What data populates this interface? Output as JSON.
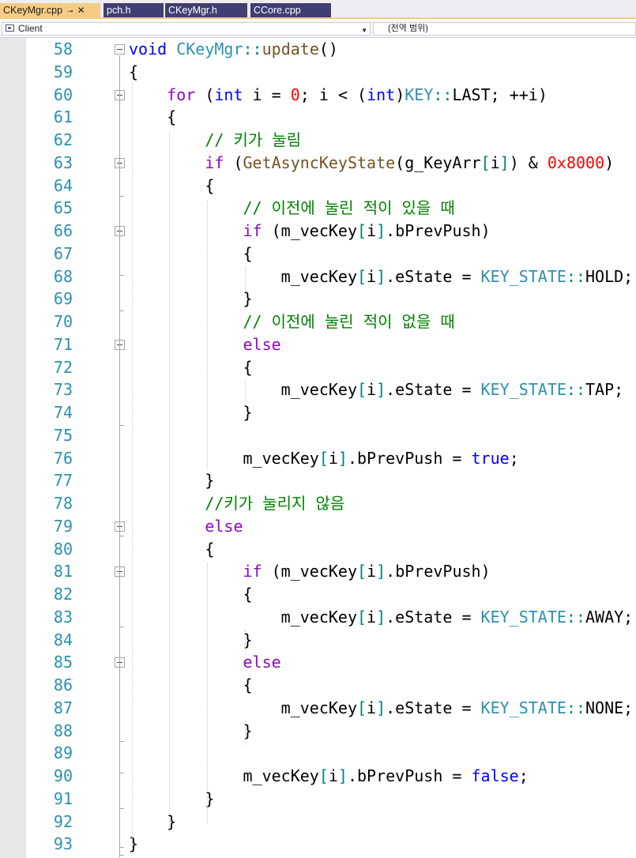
{
  "tabs": [
    {
      "label": "CKeyMgr.cpp",
      "active": true,
      "pin_icon": "pin-icon",
      "close_icon": "close-icon"
    },
    {
      "label": "pch.h",
      "active": false
    },
    {
      "label": "CKeyMgr.h",
      "active": false
    },
    {
      "label": "CCore.cpp",
      "active": false
    }
  ],
  "navbar": {
    "project": "Client",
    "scope": "(전역 범위)"
  },
  "colors": {
    "tab_active": "#f5cc84",
    "tab_inactive": "#3f3f74",
    "line_number": "#2b91af",
    "keyword": "#0000ff",
    "control_keyword": "#8f08c4",
    "function": "#74531f",
    "type": "#2b91af",
    "number": "#ff0000",
    "comment": "#008000"
  },
  "lines": [
    {
      "n": "58",
      "fold": true,
      "tokens": [
        [
          "kw",
          "void"
        ],
        [
          "",
          " "
        ],
        [
          "cls",
          "CKeyMgr"
        ],
        [
          "op",
          "::"
        ],
        [
          "fn",
          "update"
        ],
        [
          "",
          "()"
        ]
      ]
    },
    {
      "n": "59",
      "tokens": [
        [
          "",
          "{"
        ]
      ]
    },
    {
      "n": "60",
      "fold": true,
      "tokens": [
        [
          "",
          "    "
        ],
        [
          "kw2",
          "for"
        ],
        [
          "",
          ""
        ],
        [
          "",
          ""
        ],
        [
          "",
          " ("
        ],
        [
          "kw",
          "int"
        ],
        [
          "",
          " i = "
        ],
        [
          "num",
          "0"
        ],
        [
          "",
          "; i < ("
        ],
        [
          "kw",
          "int"
        ],
        [
          "",
          ")"
        ],
        [
          "cls",
          "KEY"
        ],
        [
          "op",
          "::"
        ],
        [
          "",
          "LAST; ++i)"
        ]
      ]
    },
    {
      "n": "61",
      "tokens": [
        [
          "",
          "    {"
        ]
      ]
    },
    {
      "n": "62",
      "tokens": [
        [
          "",
          "        "
        ],
        [
          "cm",
          "// 키가 눌림"
        ]
      ]
    },
    {
      "n": "63",
      "fold": true,
      "tokens": [
        [
          "",
          "        "
        ],
        [
          "kw2",
          "if"
        ],
        [
          "",
          " ("
        ],
        [
          "fn",
          "GetAsyncKeyState"
        ],
        [
          "",
          "(g_KeyArr"
        ],
        [
          "op",
          "["
        ],
        [
          "",
          "i"
        ],
        [
          "op",
          "]"
        ],
        [
          "",
          ") & "
        ],
        [
          "num",
          "0x8000"
        ],
        [
          "",
          ")"
        ]
      ]
    },
    {
      "n": "64",
      "tokens": [
        [
          "",
          "        {"
        ]
      ]
    },
    {
      "n": "65",
      "tokens": [
        [
          "",
          "            "
        ],
        [
          "cm",
          "// 이전에 눌린 적이 있을 때"
        ]
      ]
    },
    {
      "n": "66",
      "fold": true,
      "tokens": [
        [
          "",
          "            "
        ],
        [
          "kw2",
          "if"
        ],
        [
          "",
          " (m_vecKey"
        ],
        [
          "op",
          "["
        ],
        [
          "",
          "i"
        ],
        [
          "op",
          "]"
        ],
        [
          "",
          ".bPrevPush)"
        ]
      ]
    },
    {
      "n": "67",
      "tokens": [
        [
          "",
          "            {"
        ]
      ]
    },
    {
      "n": "68",
      "tokens": [
        [
          "",
          "                m_vecKey"
        ],
        [
          "op",
          "["
        ],
        [
          "",
          "i"
        ],
        [
          "op",
          "]"
        ],
        [
          "",
          ".eState = "
        ],
        [
          "cls",
          "KEY_STATE"
        ],
        [
          "op",
          "::"
        ],
        [
          "",
          "HOLD;"
        ]
      ]
    },
    {
      "n": "69",
      "tokens": [
        [
          "",
          "            }"
        ]
      ]
    },
    {
      "n": "70",
      "tokens": [
        [
          "",
          "            "
        ],
        [
          "cm",
          "// 이전에 눌린 적이 없을 때"
        ]
      ]
    },
    {
      "n": "71",
      "fold": true,
      "tokens": [
        [
          "",
          "            "
        ],
        [
          "kw2",
          "else"
        ]
      ]
    },
    {
      "n": "72",
      "tokens": [
        [
          "",
          "            {"
        ]
      ]
    },
    {
      "n": "73",
      "tokens": [
        [
          "",
          "                m_vecKey"
        ],
        [
          "op",
          "["
        ],
        [
          "",
          "i"
        ],
        [
          "op",
          "]"
        ],
        [
          "",
          ".eState = "
        ],
        [
          "cls",
          "KEY_STATE"
        ],
        [
          "op",
          "::"
        ],
        [
          "",
          "TAP;"
        ]
      ]
    },
    {
      "n": "74",
      "tokens": [
        [
          "",
          "            }"
        ]
      ]
    },
    {
      "n": "75",
      "tokens": []
    },
    {
      "n": "76",
      "tokens": [
        [
          "",
          "            m_vecKey"
        ],
        [
          "op",
          "["
        ],
        [
          "",
          "i"
        ],
        [
          "op",
          "]"
        ],
        [
          "",
          ".bPrevPush = "
        ],
        [
          "kw",
          "true"
        ],
        [
          "",
          ";"
        ]
      ]
    },
    {
      "n": "77",
      "tokens": [
        [
          "",
          "        }"
        ]
      ]
    },
    {
      "n": "78",
      "tokens": [
        [
          "",
          "        "
        ],
        [
          "cm",
          "//키가 눌리지 않음"
        ]
      ]
    },
    {
      "n": "79",
      "fold": true,
      "tokens": [
        [
          "",
          "        "
        ],
        [
          "kw2",
          "else"
        ]
      ]
    },
    {
      "n": "80",
      "tokens": [
        [
          "",
          "        {"
        ]
      ]
    },
    {
      "n": "81",
      "fold": true,
      "tokens": [
        [
          "",
          "            "
        ],
        [
          "kw2",
          "if"
        ],
        [
          "",
          " (m_vecKey"
        ],
        [
          "op",
          "["
        ],
        [
          "",
          "i"
        ],
        [
          "op",
          "]"
        ],
        [
          "",
          ".bPrevPush)"
        ]
      ]
    },
    {
      "n": "82",
      "tokens": [
        [
          "",
          "            {"
        ]
      ]
    },
    {
      "n": "83",
      "tokens": [
        [
          "",
          "                m_vecKey"
        ],
        [
          "op",
          "["
        ],
        [
          "",
          "i"
        ],
        [
          "op",
          "]"
        ],
        [
          "",
          ".eState = "
        ],
        [
          "cls",
          "KEY_STATE"
        ],
        [
          "op",
          "::"
        ],
        [
          "",
          "AWAY;"
        ]
      ]
    },
    {
      "n": "84",
      "tokens": [
        [
          "",
          "            }"
        ]
      ]
    },
    {
      "n": "85",
      "fold": true,
      "tokens": [
        [
          "",
          "            "
        ],
        [
          "kw2",
          "else"
        ]
      ]
    },
    {
      "n": "86",
      "tokens": [
        [
          "",
          "            {"
        ]
      ]
    },
    {
      "n": "87",
      "tokens": [
        [
          "",
          "                m_vecKey"
        ],
        [
          "op",
          "["
        ],
        [
          "",
          "i"
        ],
        [
          "op",
          "]"
        ],
        [
          "",
          ".eState = "
        ],
        [
          "cls",
          "KEY_STATE"
        ],
        [
          "op",
          "::"
        ],
        [
          "",
          "NONE;"
        ]
      ]
    },
    {
      "n": "88",
      "tokens": [
        [
          "",
          "            }"
        ]
      ]
    },
    {
      "n": "89",
      "tokens": []
    },
    {
      "n": "90",
      "tokens": [
        [
          "",
          "            m_vecKey"
        ],
        [
          "op",
          "["
        ],
        [
          "",
          "i"
        ],
        [
          "op",
          "]"
        ],
        [
          "",
          ".bPrevPush = "
        ],
        [
          "kw",
          "false"
        ],
        [
          "",
          ";"
        ]
      ]
    },
    {
      "n": "91",
      "tokens": [
        [
          "",
          "        }"
        ]
      ]
    },
    {
      "n": "92",
      "tokens": [
        [
          "",
          "    }"
        ]
      ]
    },
    {
      "n": "93",
      "tokens": [
        [
          "",
          "}"
        ]
      ]
    }
  ]
}
